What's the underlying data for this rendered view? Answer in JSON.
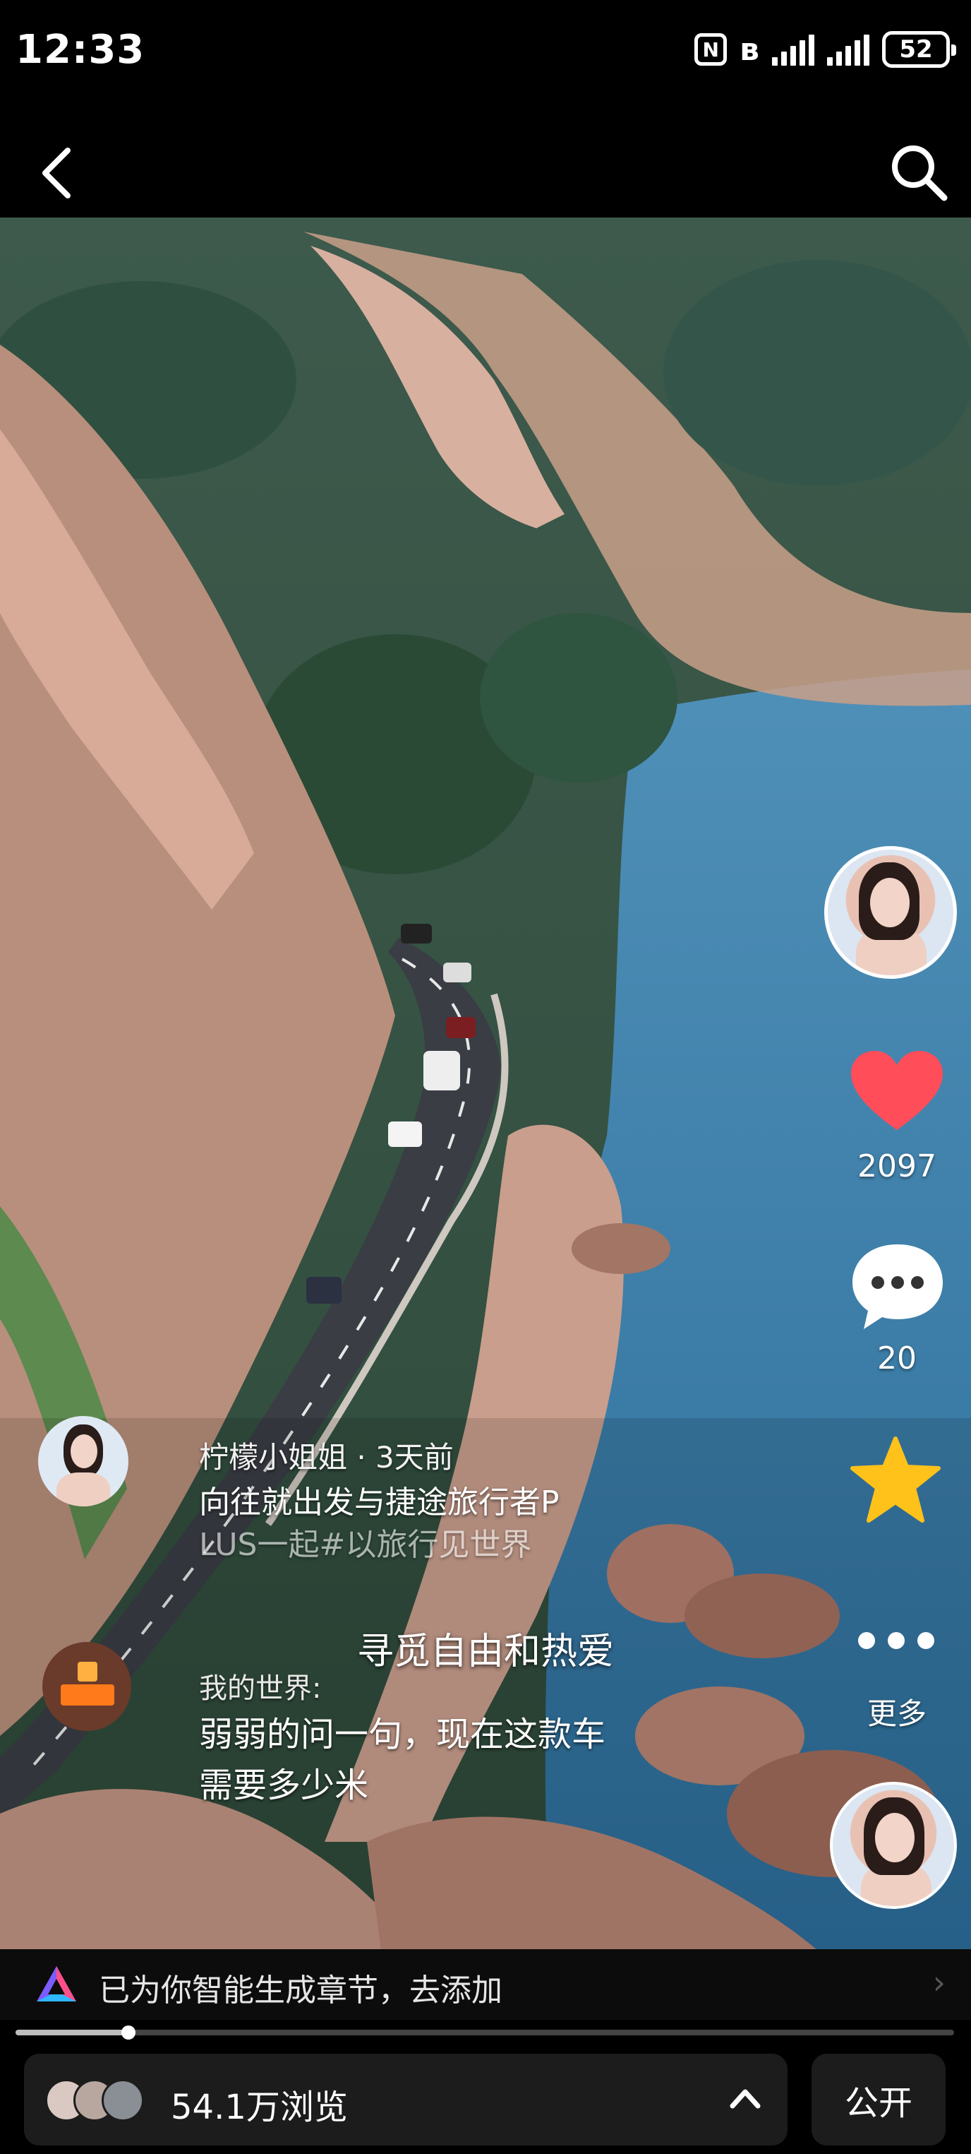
{
  "status_bar": {
    "time": "12:33",
    "nfc_label": "N",
    "bluetooth_symbol": "ʙ",
    "battery": "52",
    "network_icons": [
      "nfc-icon",
      "bluetooth-icon",
      "signal-icon",
      "signal-icon"
    ]
  },
  "header": {
    "back_icon": "chevron-left-icon",
    "search_icon": "search-icon"
  },
  "video": {
    "scene": "coastal mountain road with cars beside the sea",
    "subtitle": "寻觅自由和热爱"
  },
  "actions": {
    "like_count": "2097",
    "comment_count": "20",
    "more_label": "更多",
    "like_color": "#ff4d5a",
    "star_color": "#ffc21a"
  },
  "post": {
    "author_line": "柠檬小姐姐 · 3天前",
    "description_line1": "向往就出发与捷途旅行者P",
    "description_line2": "LUS一起#以旅行见世界"
  },
  "comment": {
    "user": "我的世界:",
    "text_line1": "弱弱的问一句，现在这款车",
    "text_line2": "需要多少米"
  },
  "chapter": {
    "text": "已为你智能生成章节，去添加"
  },
  "playback": {
    "progress": 0.12
  },
  "bottom": {
    "views": "54.1万浏览",
    "public_label": "公开"
  }
}
